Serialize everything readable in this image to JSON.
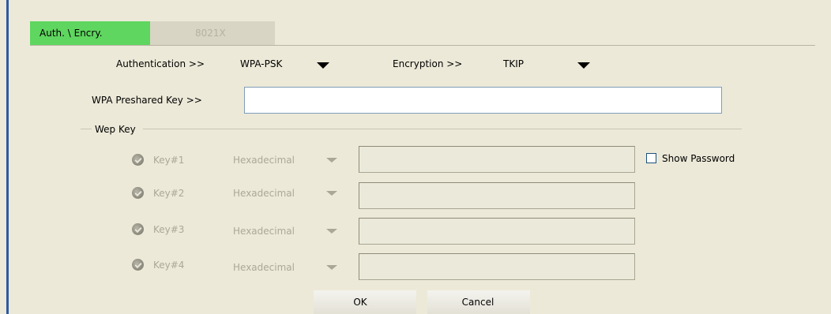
{
  "tabs": [
    {
      "label": "Auth. \\ Encry.",
      "active": true
    },
    {
      "label": "8021X",
      "active": false
    }
  ],
  "auth": {
    "label": "Authentication >>",
    "value": "WPA-PSK",
    "encryption_label": "Encryption >>",
    "encryption_value": "TKIP"
  },
  "psk": {
    "label": "WPA Preshared Key >>",
    "value": ""
  },
  "wep": {
    "group_label": "Wep Key",
    "keys": [
      {
        "label": "Key#1",
        "format": "Hexadecimal",
        "value": ""
      },
      {
        "label": "Key#2",
        "format": "Hexadecimal",
        "value": ""
      },
      {
        "label": "Key#3",
        "format": "Hexadecimal",
        "value": ""
      },
      {
        "label": "Key#4",
        "format": "Hexadecimal",
        "value": ""
      }
    ],
    "show_password_label": "Show Password",
    "show_password_checked": false
  },
  "buttons": {
    "ok": "OK",
    "cancel": "Cancel"
  },
  "colors": {
    "background": "#ece9d8",
    "active_tab": "#5fd65f",
    "accent_bar": "#2c5aa0"
  }
}
